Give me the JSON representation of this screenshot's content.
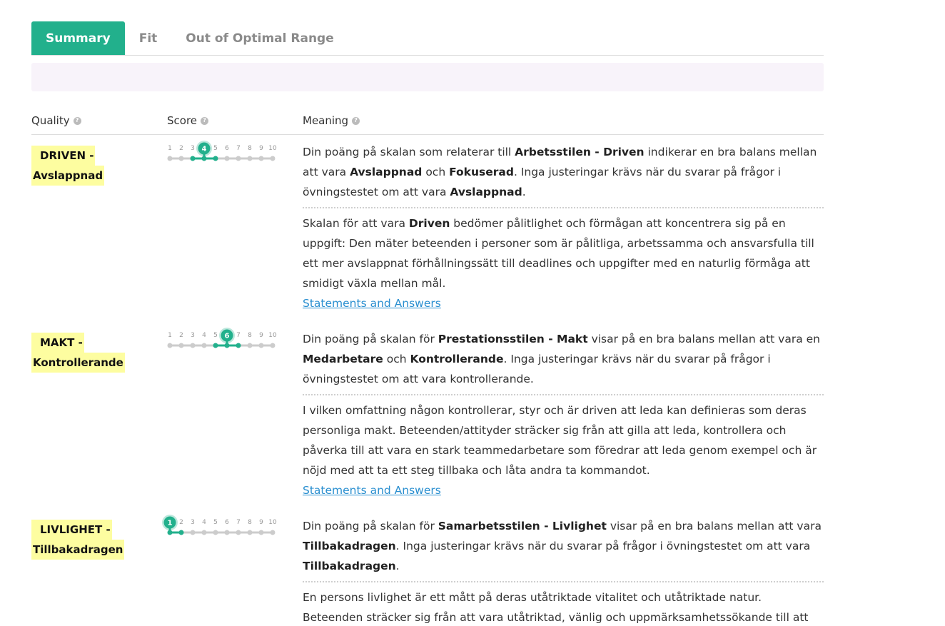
{
  "tabs": [
    {
      "label": "Summary",
      "active": true
    },
    {
      "label": "Fit",
      "active": false
    },
    {
      "label": "Out of Optimal Range",
      "active": false
    }
  ],
  "headers": {
    "quality": "Quality",
    "score": "Score",
    "meaning": "Meaning",
    "help_icon": "?"
  },
  "scale": {
    "ticks": [
      "1",
      "2",
      "3",
      "4",
      "5",
      "6",
      "7",
      "8",
      "9",
      "10"
    ],
    "accent": "#22b08c",
    "track": "#cccccc"
  },
  "rows": [
    {
      "quality_line1": "DRIVEN -",
      "quality_line2": "Avslappnad",
      "score": 4,
      "range": [
        3,
        5
      ],
      "meaning": {
        "p1_a": "Din poäng på skalan som relaterar till ",
        "p1_b": "Arbetsstilen - Driven",
        "p1_c": " indikerar en bra balans mellan att vara ",
        "p1_d": "Avslappnad",
        "p1_e": " och ",
        "p1_f": "Fokuserad",
        "p1_g": ". Inga justeringar krävs när du svarar på frågor i övningstestet om att vara ",
        "p1_h": "Avslappnad",
        "p1_i": ".",
        "p2_a": "Skalan för att vara ",
        "p2_b": "Driven",
        "p2_c": " bedömer pålitlighet och förmågan att koncentrera sig på en uppgift: Den mäter beteenden i personer som är pålitliga, arbetssamma och ansvarsfulla till ett mer avslappnat förhållningssätt till deadlines och uppgifter med en naturlig förmåga att smidigt växla mellan mål.",
        "link": "Statements and Answers"
      }
    },
    {
      "quality_line1": "MAKT -",
      "quality_line2": "Kontrollerande",
      "score": 6,
      "range": [
        5,
        7
      ],
      "meaning": {
        "p1_a": "Din poäng på skalan för ",
        "p1_b": "Prestationsstilen - Makt",
        "p1_c": " visar på en bra balans mellan att vara en ",
        "p1_d": "Medarbetare",
        "p1_e": " och ",
        "p1_f": "Kontrollerande",
        "p1_g": ". Inga justeringar krävs när du svarar på frågor i övningstestet om att vara kontrollerande.",
        "p2": "I vilken omfattning någon kontrollerar, styr och är driven att leda kan definieras som deras personliga makt. Beteenden/attityder sträcker sig från att gilla att leda, kontrollera och påverka till att vara en stark teammedarbetare som föredrar att leda genom exempel och är nöjd med att ta ett steg tillbaka och låta andra ta kommandot.",
        "link": "Statements and Answers"
      }
    },
    {
      "quality_line1": "LIVLIGHET -",
      "quality_line2": "Tillbakadragen",
      "score": 1,
      "range": [
        1,
        2
      ],
      "meaning": {
        "p1_a": "Din poäng på skalan för ",
        "p1_b": "Samarbetsstilen - Livlighet",
        "p1_c": " visar på en bra balans mellan att vara ",
        "p1_d": "Tillbakadragen",
        "p1_e": ". Inga justeringar krävs när du svarar på frågor i övningstestet om att vara ",
        "p1_f": "Tillbakadragen",
        "p1_g": ".",
        "p2": "En persons livlighet är ett mått på deras utåtriktade vitalitet och utåtriktade natur. Beteenden sträcker sig från att vara utåtriktad, vänlig och uppmärksamhetssökande till att vara tyst,"
      }
    }
  ]
}
